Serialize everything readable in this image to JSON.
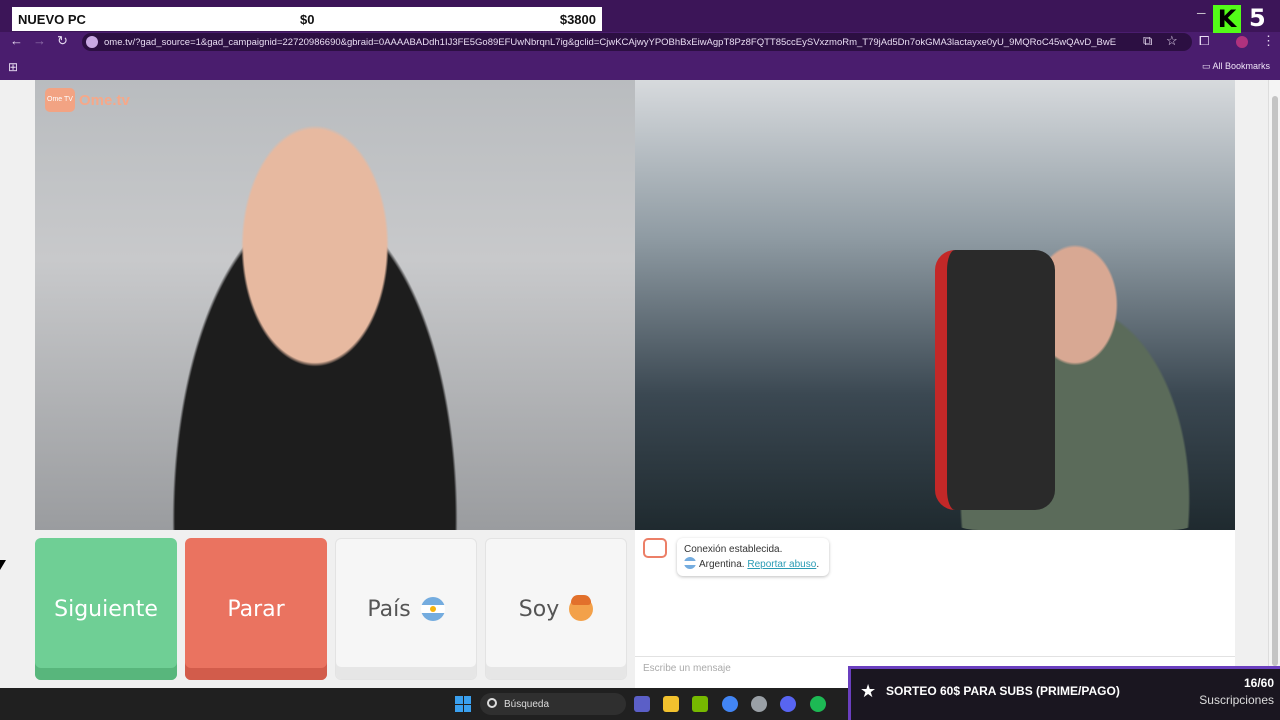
{
  "overlay": {
    "goal_label": "NUEVO PC",
    "goal_current": "$0",
    "goal_target": "$3800",
    "kick_logo": "K",
    "kick_number": "5"
  },
  "browser": {
    "url": "ome.tv/?gad_source=1&gad_campaignid=22720986690&gbraid=0AAAABADdh1IJ3FE5Go89EFUwNbrqnL7ig&gclid=CjwKCAjwyYPOBhBxEiwAgpT8Pz8FQTT85ccEySVxzmoRm_T79jAd5Dn7okGMA3lactayxe0yU_9MQRoC45wQAvD_BwE",
    "all_bookmarks": "All Bookmarks"
  },
  "page": {
    "logo_text": "Ome.tv",
    "logo_badge": "Ome TV",
    "buttons": {
      "next": "Siguiente",
      "stop": "Parar",
      "country": "País",
      "soy": "Soy"
    },
    "chat": {
      "connection": "Conexión establecida.",
      "country": "Argentina.",
      "report": "Reportar abuso",
      "report_suffix": ".",
      "placeholder": "Escribe un mensaje"
    }
  },
  "taskbar": {
    "search_text": "Búsqueda"
  },
  "subs_panel": {
    "title": "SORTEO 60$ PARA SUBS (PRIME/PAGO)",
    "count": "16/60",
    "label": "Suscripciones"
  },
  "colors": {
    "next": "#6fcf95",
    "stop": "#ea7360",
    "chrome": "#4a1d6e",
    "kick_green": "#53fc18"
  }
}
